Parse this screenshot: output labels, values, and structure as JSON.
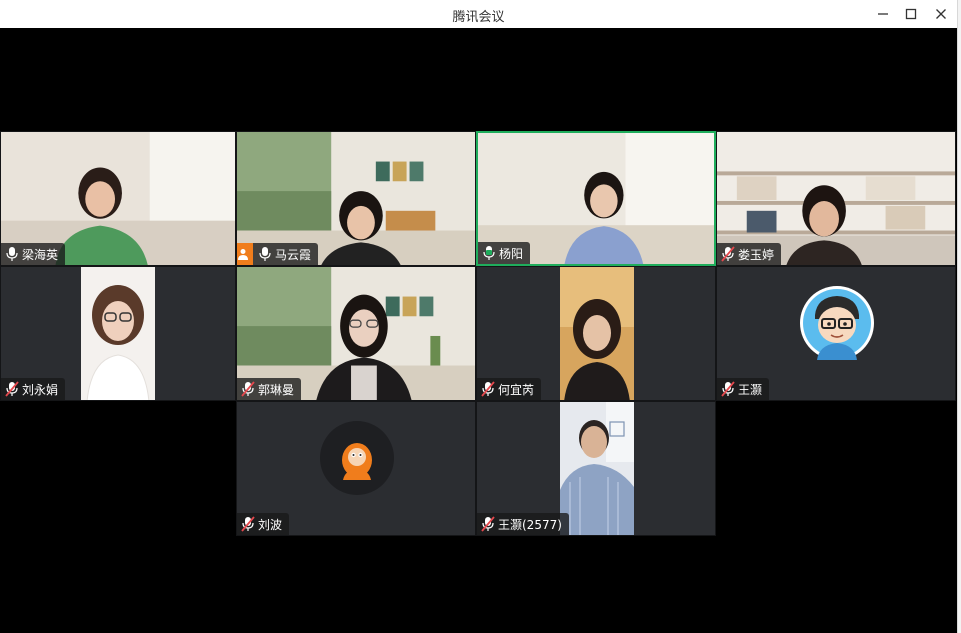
{
  "window": {
    "title": "腾讯会议",
    "controls": [
      "minimize",
      "maximize",
      "close"
    ]
  },
  "participants": [
    {
      "name": "梁海英",
      "mic": "on",
      "video": true,
      "room": "light"
    },
    {
      "name": "马云霞",
      "mic": "on",
      "video": true,
      "host": true,
      "room": "garden"
    },
    {
      "name": "杨阳",
      "mic": "on-active",
      "video": true,
      "speaking": true,
      "room": "light"
    },
    {
      "name": "娄玉婷",
      "mic": "muted",
      "video": true,
      "room": "shelf"
    },
    {
      "name": "刘永娟",
      "mic": "muted",
      "video": true,
      "room": "white"
    },
    {
      "name": "郭琳曼",
      "mic": "muted",
      "video": true,
      "room": "garden"
    },
    {
      "name": "何宜芮",
      "mic": "muted",
      "video": true,
      "room": "warm"
    },
    {
      "name": "王灏",
      "mic": "muted",
      "video": false,
      "avatar": "cartoon-boy-glasses"
    },
    {
      "name": "刘波",
      "mic": "muted",
      "video": false,
      "avatar": "cartoon-orange-hood"
    },
    {
      "name": "王灏(2577)",
      "mic": "muted",
      "video": true,
      "room": "office"
    }
  ],
  "colors": {
    "stage": "#000000",
    "tile": "#2b2d31",
    "active_border": "#1fad5c",
    "host_badge": "#f07d1c",
    "muted_mic": "#e5484d"
  }
}
